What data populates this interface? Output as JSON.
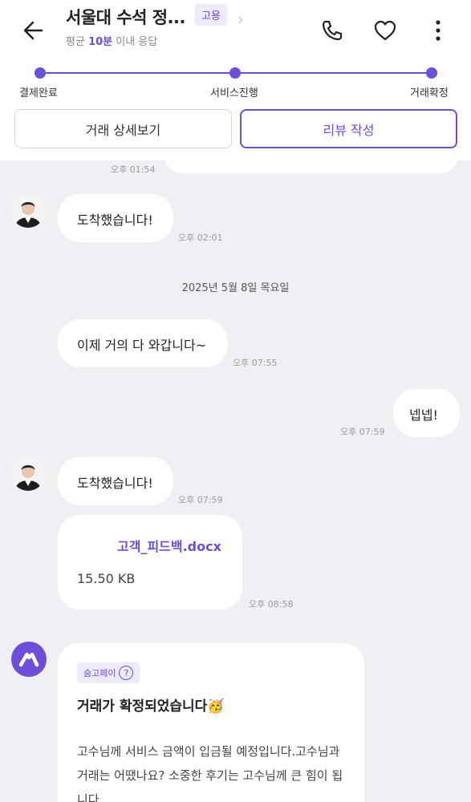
{
  "header": {
    "title": "서울대 수석 정...",
    "hire_badge": "고용",
    "subtitle_prefix": "평균 ",
    "subtitle_highlight": "10분",
    "subtitle_suffix": " 이내 응답",
    "back_icon": "arrow-left-icon",
    "call_icon": "phone-icon",
    "like_icon": "heart-icon",
    "more_icon": "more-vertical-icon"
  },
  "progress": {
    "steps": [
      "결제완료",
      "서비스진행",
      "거래확정"
    ],
    "accent": "#6e4ed9"
  },
  "tabs": {
    "detail_label": "거래 상세보기",
    "review_label": "리뷰 작성"
  },
  "messages": {
    "partial_time": "오후 01:54",
    "msg1_text": "도착했습니다!",
    "msg1_time": "오후 02:01",
    "date_separator": "2025년 5월 8일 목요일",
    "msg2_text": "이제 거의 다 와갑니다~",
    "msg2_time": "오후 07:55",
    "msg3_text": "넵넵!",
    "msg3_time": "오후 07:59",
    "msg4_text": "도착했습니다!",
    "msg4_time": "오후 07:59",
    "file_name": "고객_피드백.docx",
    "file_size": "15.50 KB",
    "file_time": "오후 08:58"
  },
  "pay_card": {
    "badge": "숨고페이",
    "badge_icon": "question-circle-icon",
    "title": "거래가 확정되었습니다",
    "title_emoji": "🥳",
    "body": "고수님께 서비스 금액이 입금될 예정입니다.고수님과 거래는 어땠나요? 소중한 후기는 고수님께 큰 힘이 됩니다."
  },
  "colors": {
    "accent": "#6e4ed9",
    "chat_bg": "#eef0f4",
    "badge_bg": "#efeafe"
  }
}
